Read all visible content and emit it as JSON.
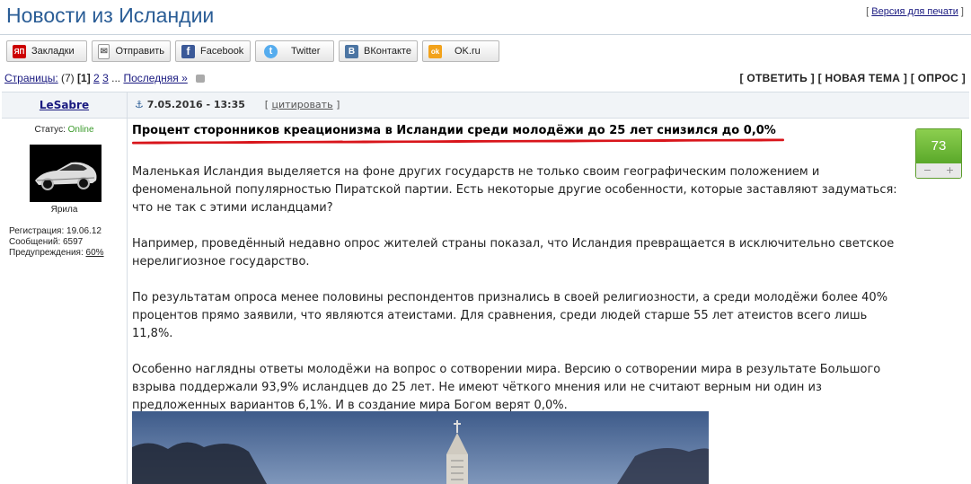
{
  "header": {
    "title": "Новости из Исландии",
    "print_link": "Версия для печати"
  },
  "share": [
    {
      "label": "Закладки",
      "icon": "yandex-bookmarks-icon",
      "glyph": "ЯП",
      "color": "#cc0000"
    },
    {
      "label": "Отправить",
      "icon": "envelope-icon",
      "glyph": "✉",
      "color": "#ffffff"
    },
    {
      "label": "Facebook",
      "icon": "facebook-icon",
      "glyph": "f",
      "color": "#3b5998"
    },
    {
      "label": "Twitter",
      "icon": "twitter-icon",
      "glyph": "t",
      "color": "#55acee"
    },
    {
      "label": "ВКонтакте",
      "icon": "vk-icon",
      "glyph": "В",
      "color": "#4c75a3"
    },
    {
      "label": "OK.ru",
      "icon": "ok-icon",
      "glyph": "ok",
      "color": "#f2a21b"
    }
  ],
  "pagination": {
    "label": "Страницы:",
    "count": "(7)",
    "current": "[1]",
    "page2": "2",
    "page3": "3",
    "ellipsis": "...",
    "last": "Последняя »"
  },
  "actions": {
    "reply": "[ ОТВЕТИТЬ ]",
    "new_topic": "[ НОВАЯ ТЕМА ]",
    "poll": "[ ОПРОС ]"
  },
  "post": {
    "author": "LeSabre",
    "anchor": "⚓",
    "date": "7.05.2016 - 13:35",
    "quote_open": "[",
    "quote": "цитировать",
    "quote_close": "]",
    "status_label": "Статус:",
    "status_value": "Online",
    "avatar_caption": "Ярила",
    "registration": "Регистрация: 19.06.12",
    "messages": "Сообщений: 6597",
    "warnings_label": "Предупреждения:",
    "warnings_value": "60%",
    "rating": "73",
    "rating_minus": "−",
    "rating_plus": "+",
    "headline": "Процент сторонников креационизма в Исландии среди молодёжи до 25 лет снизился до 0,0%",
    "paragraphs": [
      "Маленькая Исландия выделяется на фоне других государств не только своим географическим положением и феноменальной популярностью Пиратской партии. Есть некоторые другие особенности, которые заставляют задуматься: что не так с этими исландцами?",
      "Например, проведённый недавно опрос жителей страны показал, что Исландия превращается в исключительно светское нерелигиозное государство.",
      "По результатам опроса менее половины респондентов признались в своей религиозности, а среди молодёжи более 40% процентов прямо заявили, что являются атеистами. Для сравнения, среди людей старше 55 лет атеистов всего лишь 11,8%.",
      "Особенно наглядны ответы молодёжи на вопрос о сотворении мира. Версию о сотворении мира в результате Большого взрыва поддержали 93,9% исландцев до 25 лет. Не имеют чёткого мнения или не считают верным ни один из предложенных вариантов 6,1%. И в создание мира Богом верят 0,0%."
    ]
  },
  "colors": {
    "title": "#2a5d96",
    "online": "#3a9a2a",
    "headline_underline": "#d8151b",
    "rating_green": "#6cb83a"
  }
}
